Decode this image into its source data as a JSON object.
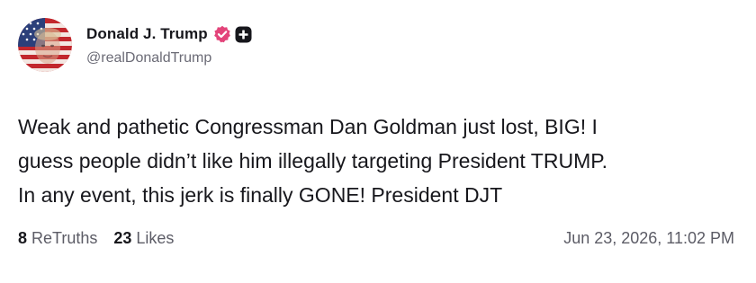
{
  "author": {
    "display_name": "Donald J. Trump",
    "handle": "@realDonaldTrump",
    "avatar_icon": "avatar-flag-portrait",
    "verified_icon": "verified-badge-icon",
    "verified_color": "#e3447a",
    "extra_icon": "plus-badge-icon"
  },
  "post": {
    "text": "Weak and pathetic Congressman Dan Goldman just lost, BIG! I\nguess people didn’t like him illegally targeting President TRUMP.\nIn any event, this jerk is finally GONE! President DJT"
  },
  "stats": {
    "retruths_count": "8",
    "retruths_label": "ReTruths",
    "likes_count": "23",
    "likes_label": "Likes"
  },
  "timestamp": "Jun 23, 2026, 11:02 PM"
}
